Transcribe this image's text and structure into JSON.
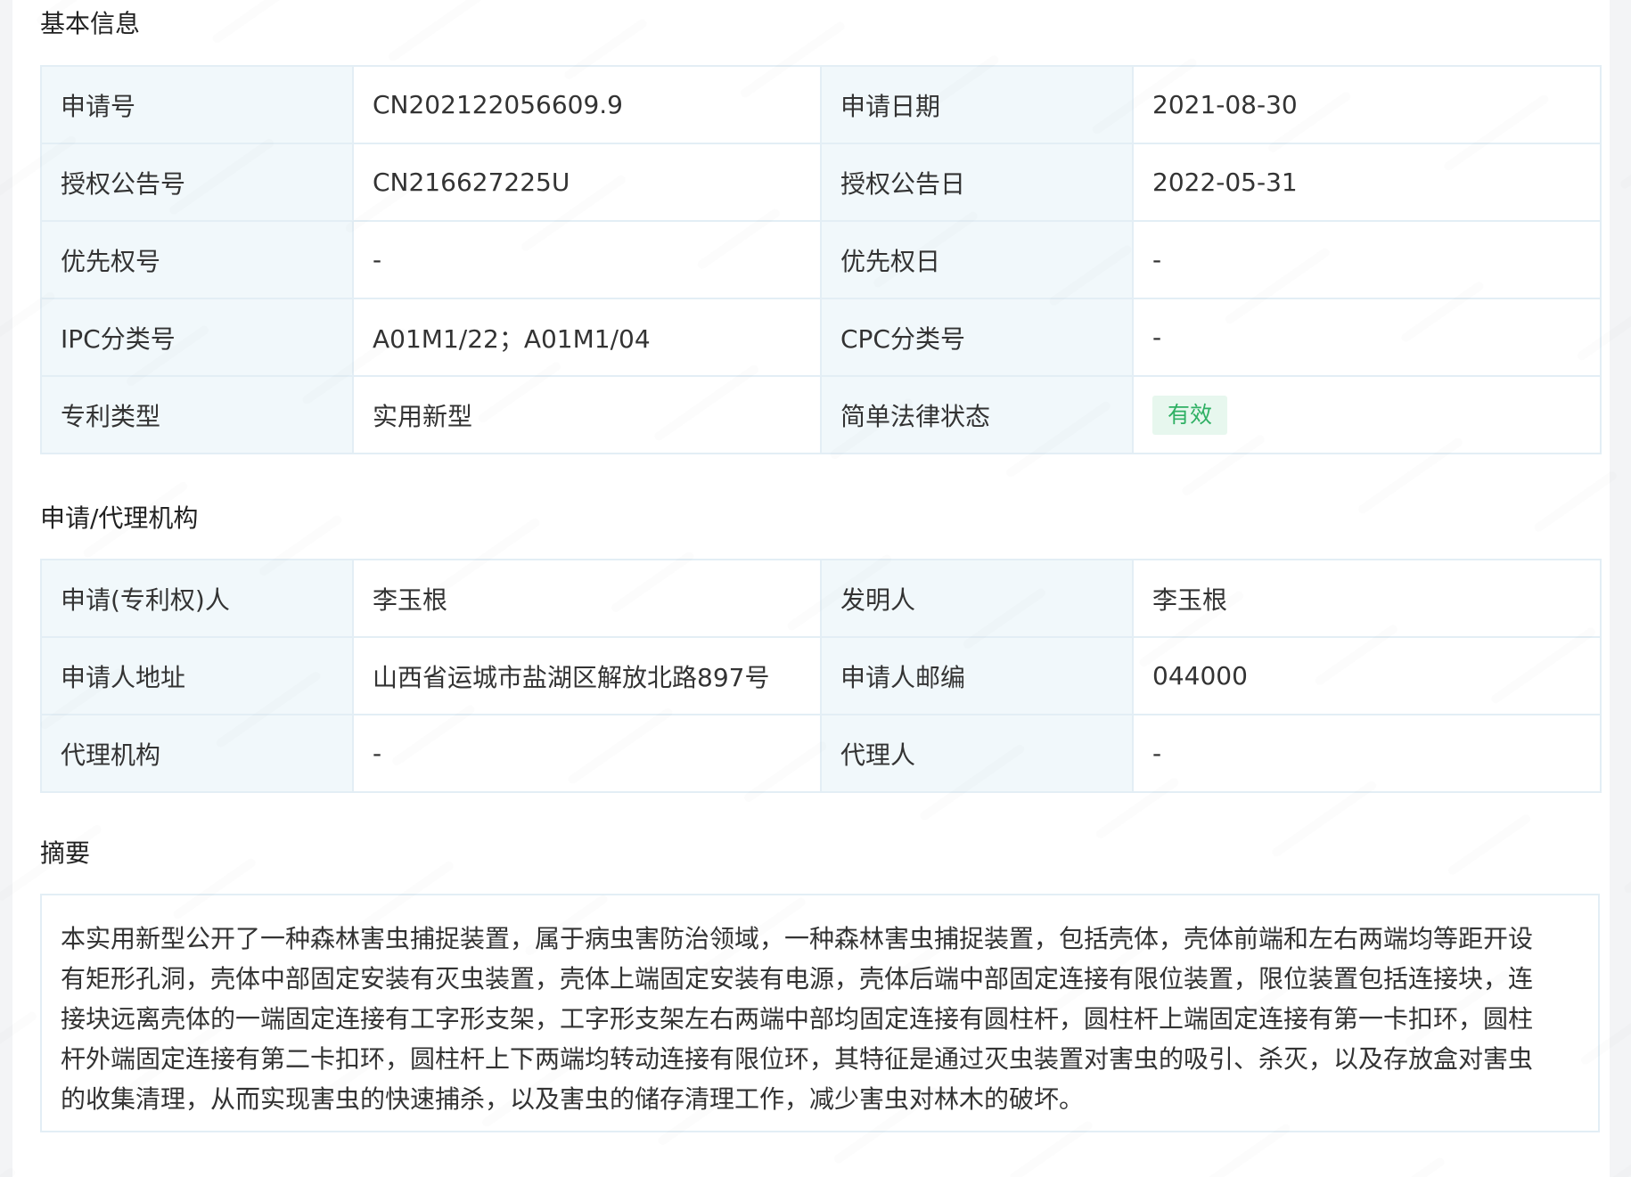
{
  "basic_info": {
    "title": "基本信息",
    "rows": [
      [
        {
          "label": "申请号",
          "value": "CN202122056609.9"
        },
        {
          "label": "申请日期",
          "value": "2021-08-30"
        }
      ],
      [
        {
          "label": "授权公告号",
          "value": "CN216627225U"
        },
        {
          "label": "授权公告日",
          "value": "2022-05-31"
        }
      ],
      [
        {
          "label": "优先权号",
          "value": "-"
        },
        {
          "label": "优先权日",
          "value": "-"
        }
      ],
      [
        {
          "label": "IPC分类号",
          "value": "A01M1/22；A01M1/04"
        },
        {
          "label": "CPC分类号",
          "value": "-"
        }
      ],
      [
        {
          "label": "专利类型",
          "value": "实用新型"
        },
        {
          "label": "简单法律状态",
          "value": "有效"
        }
      ]
    ]
  },
  "agency": {
    "title": "申请/代理机构",
    "rows": [
      [
        {
          "label": "申请(专利权)人",
          "value": "李玉根"
        },
        {
          "label": "发明人",
          "value": "李玉根"
        }
      ],
      [
        {
          "label": "申请人地址",
          "value": "山西省运城市盐湖区解放北路897号"
        },
        {
          "label": "申请人邮编",
          "value": "044000"
        }
      ],
      [
        {
          "label": "代理机构",
          "value": "-"
        },
        {
          "label": "代理人",
          "value": "-"
        }
      ]
    ]
  },
  "abstract": {
    "title": "摘要",
    "text": "本实用新型公开了一种森林害虫捕捉装置，属于病虫害防治领域，一种森林害虫捕捉装置，包括壳体，壳体前端和左右两端均等距开设有矩形孔洞，壳体中部固定安装有灭虫装置，壳体上端固定安装有电源，壳体后端中部固定连接有限位装置，限位装置包括连接块，连接块远离壳体的一端固定连接有工字形支架，工字形支架左右两端中部均固定连接有圆柱杆，圆柱杆上端固定连接有第一卡扣环，圆柱杆外端固定连接有第二卡扣环，圆柱杆上下两端均转动连接有限位环，其特征是通过灭虫装置对害虫的吸引、杀灭，以及存放盒对害虫的收集清理，从而实现害虫的快速捕杀，以及害虫的储存清理工作，减少害虫对林木的破坏。"
  },
  "colors": {
    "label_bg": "#f1f8fb",
    "border": "#e3eef5",
    "status_badge_bg": "#e7f7ee",
    "status_badge_text": "#2fb064"
  }
}
